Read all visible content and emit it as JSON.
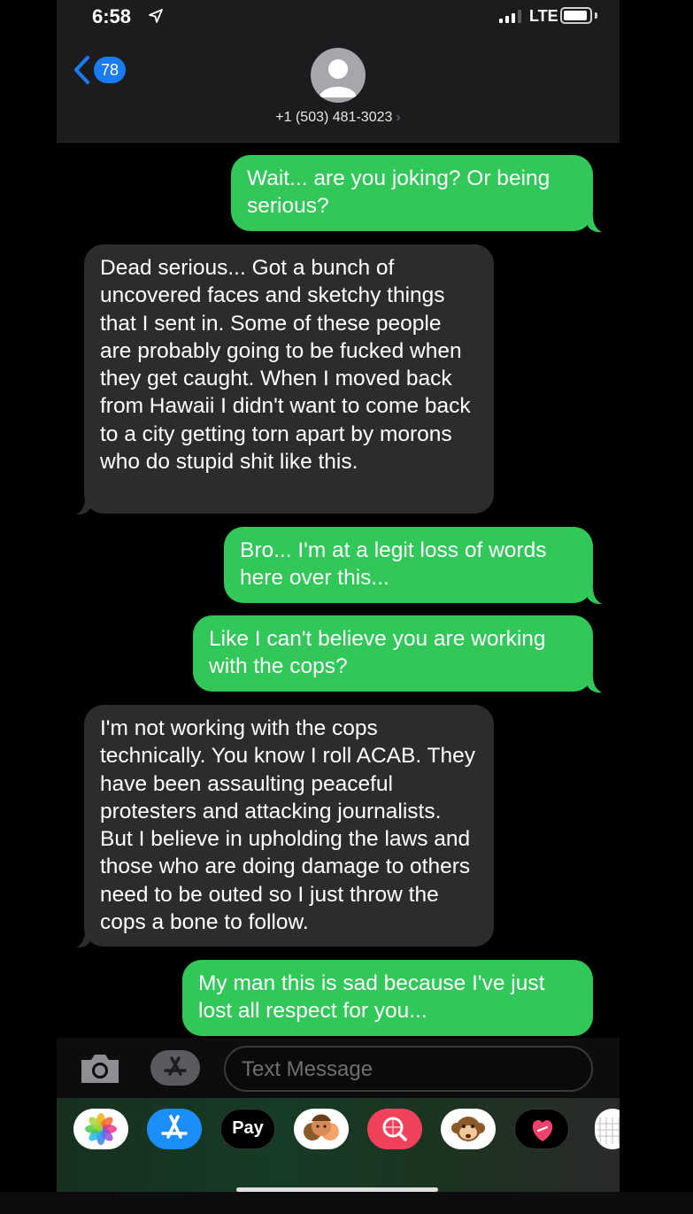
{
  "status_bar": {
    "time": "6:58",
    "network": "LTE"
  },
  "header": {
    "back_count": "78",
    "contact": "+1 (503) 481-3023",
    "chevron": "›"
  },
  "messages": [
    {
      "from": "me",
      "text": "Wait... are you joking? Or being serious?"
    },
    {
      "from": "them",
      "text": "Dead serious... Got a bunch of uncovered faces and sketchy things that I sent in. Some of these people are probably going to be fucked when they get caught. When I moved back from Hawaii I didn't want to come back to a city getting torn apart by morons who do stupid shit like this."
    },
    {
      "from": "me",
      "text": "Bro... I'm at a legit loss of words here over this..."
    },
    {
      "from": "me",
      "text": "Like I can't believe you are working with the cops?"
    },
    {
      "from": "them",
      "text": "I'm not working with the cops technically. You know I roll ACAB. They have been assaulting peaceful protesters and attacking journalists. But I believe in upholding the laws and those who are doing damage to others need to be outed so I just throw the cops a bone to follow."
    },
    {
      "from": "me",
      "text": "My man this is sad because I've just lost all respect for you..."
    }
  ],
  "input": {
    "placeholder": "Text Message"
  },
  "apps": {
    "icons": [
      "photos-icon",
      "app-store-icon",
      "apple-pay-icon",
      "memoji-icon",
      "search-images-icon",
      "animoji-icon",
      "digital-touch-icon",
      "more-apps-icon"
    ],
    "apple_pay_label": "Pay",
    "apple_logo": ""
  },
  "colors": {
    "sent": "#32c759",
    "received": "#2c2c2e",
    "accent": "#1a7cf5"
  }
}
